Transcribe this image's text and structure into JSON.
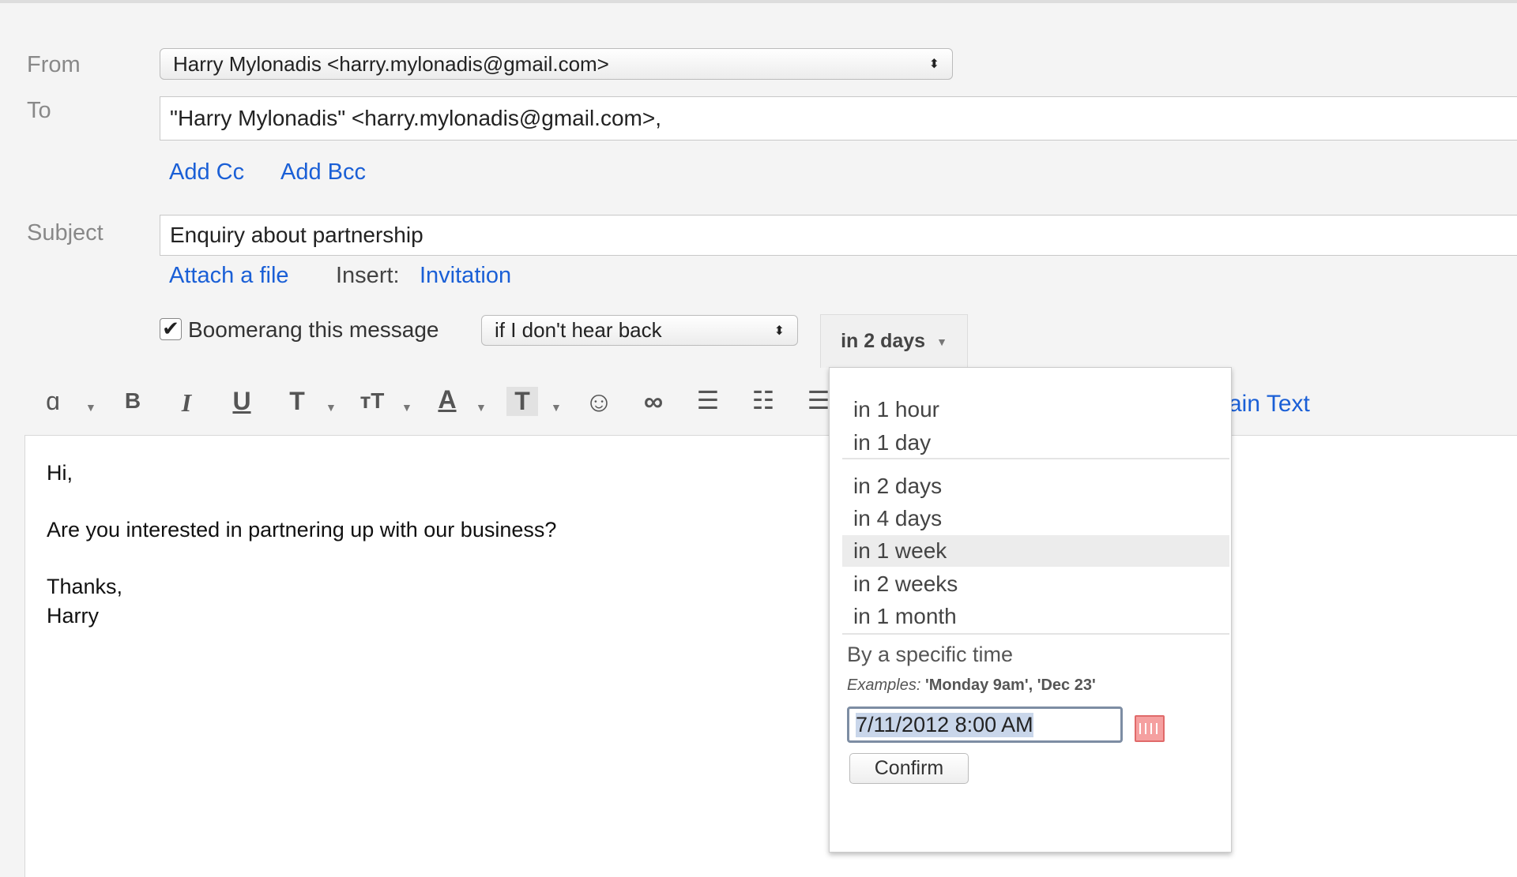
{
  "compose": {
    "from_label": "From",
    "from_value": "Harry Mylonadis <harry.mylonadis@gmail.com>",
    "to_label": "To",
    "to_value": "\"Harry Mylonadis\" <harry.mylonadis@gmail.com>,",
    "add_cc": "Add Cc",
    "add_bcc": "Add Bcc",
    "subject_label": "Subject",
    "subject_value": "Enquiry about partnership",
    "attach": "Attach a file",
    "insert_label": "Insert:",
    "invitation": "Invitation"
  },
  "boomerang": {
    "checked": true,
    "label": "Boomerang this message",
    "condition": "if I don't hear back",
    "when": "in 2 days"
  },
  "toolbar": {
    "plain_text": "ain Text"
  },
  "body": {
    "line1": "Hi,",
    "line2": "Are you interested in partnering up with our business?",
    "line3": "Thanks,",
    "line4": "Harry"
  },
  "dropdown": {
    "items": [
      "in 1 hour",
      "in 1 day",
      "in 2 days",
      "in 4 days",
      "in 1 week",
      "in 2 weeks",
      "in 1 month"
    ],
    "highlighted": "in 1 week",
    "specific_label": "By a specific time",
    "examples_prefix": "Examples:",
    "examples": "'Monday 9am', 'Dec 23'",
    "datetime_value": "7/11/2012 8:00 AM",
    "confirm": "Confirm"
  }
}
